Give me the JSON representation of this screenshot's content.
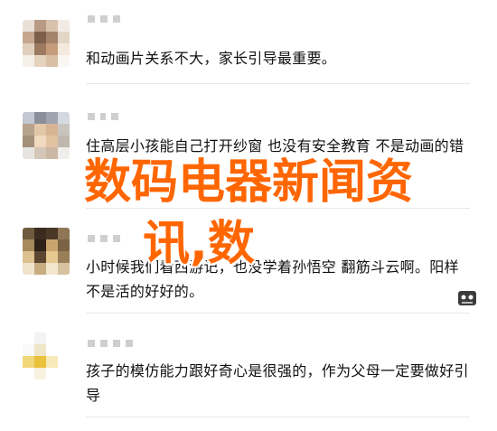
{
  "comments": [
    {
      "text": "和动画片关系不大，家长引导最重要。"
    },
    {
      "text": "住高层小孩能自己打开纱窗 也没有安全教育 不是动画的错"
    },
    {
      "text": "小时候我们看西游记，也没学着孙悟空 翻筋斗云啊。阳样不是活的好好的。"
    },
    {
      "text": "孩子的模仿能力跟好奇心是很强的，作为父母一定要做好引导"
    }
  ],
  "overlay": {
    "line1": "数码电器新闻资",
    "line2": "讯,数"
  },
  "colors": {
    "overlay": "#ff6600",
    "text": "#111111",
    "separator": "#e8e8e8"
  }
}
